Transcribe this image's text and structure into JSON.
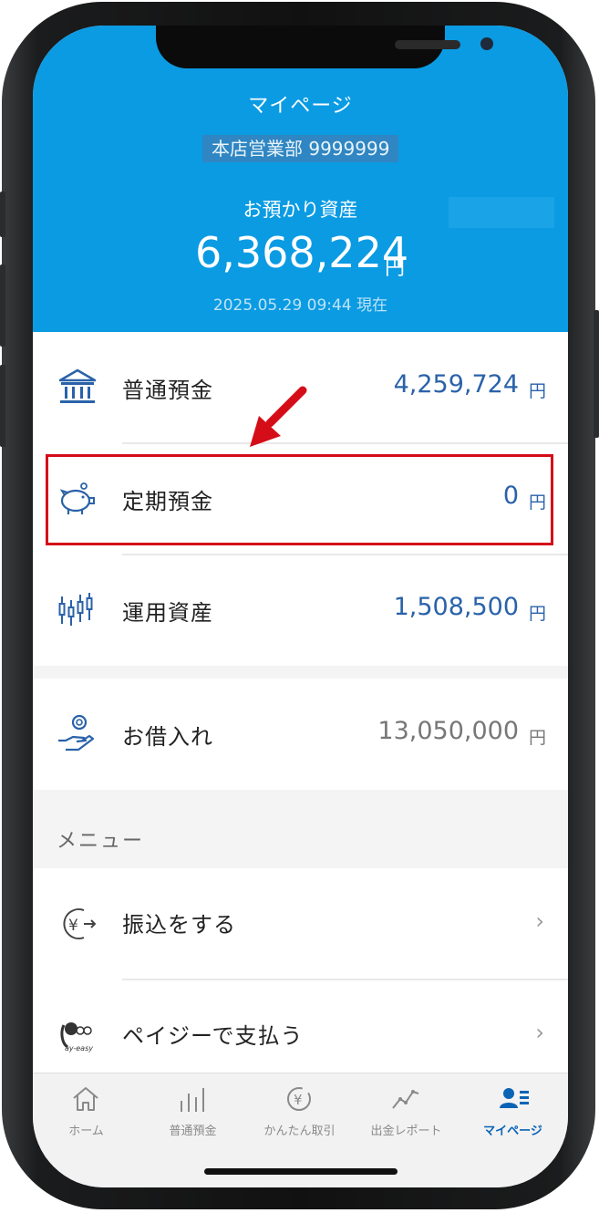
{
  "header": {
    "title": "マイページ",
    "branch": "本店営業部 9999999",
    "assets_label": "お預かり資産",
    "assets_value": "6,368,224",
    "assets_unit": "円",
    "as_of": "2025.05.29 09:44 現在"
  },
  "accounts": [
    {
      "label": "普通預金",
      "amount": "4,259,724",
      "unit": "円",
      "icon": "bank-icon"
    },
    {
      "label": "定期預金",
      "amount": "0",
      "unit": "円",
      "icon": "piggy-bank-icon"
    },
    {
      "label": "運用資産",
      "amount": "1,508,500",
      "unit": "円",
      "icon": "candlestick-icon"
    }
  ],
  "loan": {
    "label": "お借入れ",
    "amount": "13,050,000",
    "unit": "円",
    "icon": "hand-coin-icon"
  },
  "menu": {
    "heading": "メニュー",
    "items": [
      {
        "label": "振込をする",
        "icon": "yen-transfer-icon",
        "chevron": "›"
      },
      {
        "label": "ペイジーで支払う",
        "icon": "pay-easy-icon",
        "chevron": "›"
      }
    ]
  },
  "tabs": [
    {
      "label": "ホーム",
      "icon": "home-icon"
    },
    {
      "label": "普通預金",
      "icon": "bars-icon"
    },
    {
      "label": "かんたん取引",
      "icon": "yen-cycle-icon"
    },
    {
      "label": "出金レポート",
      "icon": "line-chart-icon"
    },
    {
      "label": "マイページ",
      "icon": "user-card-icon",
      "active": true
    }
  ],
  "colors": {
    "header": "#0a9be3",
    "amount": "#2a62a9",
    "highlight": "#d50d18",
    "active_tab": "#0a63b5"
  }
}
